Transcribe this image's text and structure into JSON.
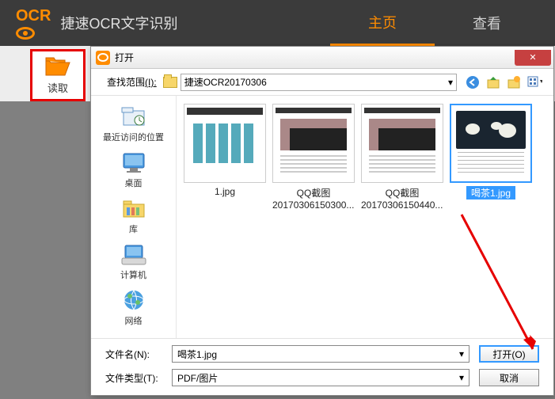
{
  "app": {
    "logo_text": "OCR",
    "title": "捷速OCR文字识别",
    "tabs": [
      {
        "label": "主页",
        "active": true
      },
      {
        "label": "查看",
        "active": false
      }
    ]
  },
  "toolbar": {
    "read_label": "读取"
  },
  "dialog": {
    "title": "打开",
    "path_label": "查找范围",
    "path_mnemonic": "(I):",
    "current_folder": "捷速OCR20170306",
    "close_symbol": "✕",
    "sidebar": [
      {
        "label": "最近访问的位置",
        "icon": "recent"
      },
      {
        "label": "桌面",
        "icon": "desktop"
      },
      {
        "label": "库",
        "icon": "libraries"
      },
      {
        "label": "计算机",
        "icon": "computer"
      },
      {
        "label": "网络",
        "icon": "network"
      }
    ],
    "files": [
      {
        "label": "1.jpg",
        "selected": false,
        "thumb": "t1"
      },
      {
        "label": "QQ截图20170306150300....",
        "selected": false,
        "thumb": "t2",
        "wrap": true
      },
      {
        "label": "QQ截图20170306150440....",
        "selected": false,
        "thumb": "t3",
        "wrap": true
      },
      {
        "label": "喝茶1.jpg",
        "selected": true,
        "thumb": "t4"
      }
    ],
    "filename_label": "文件名(N):",
    "filename_value": "喝茶1.jpg",
    "filetype_label": "文件类型(T):",
    "filetype_value": "PDF/图片",
    "open_btn": "打开(O)",
    "cancel_btn": "取消"
  }
}
